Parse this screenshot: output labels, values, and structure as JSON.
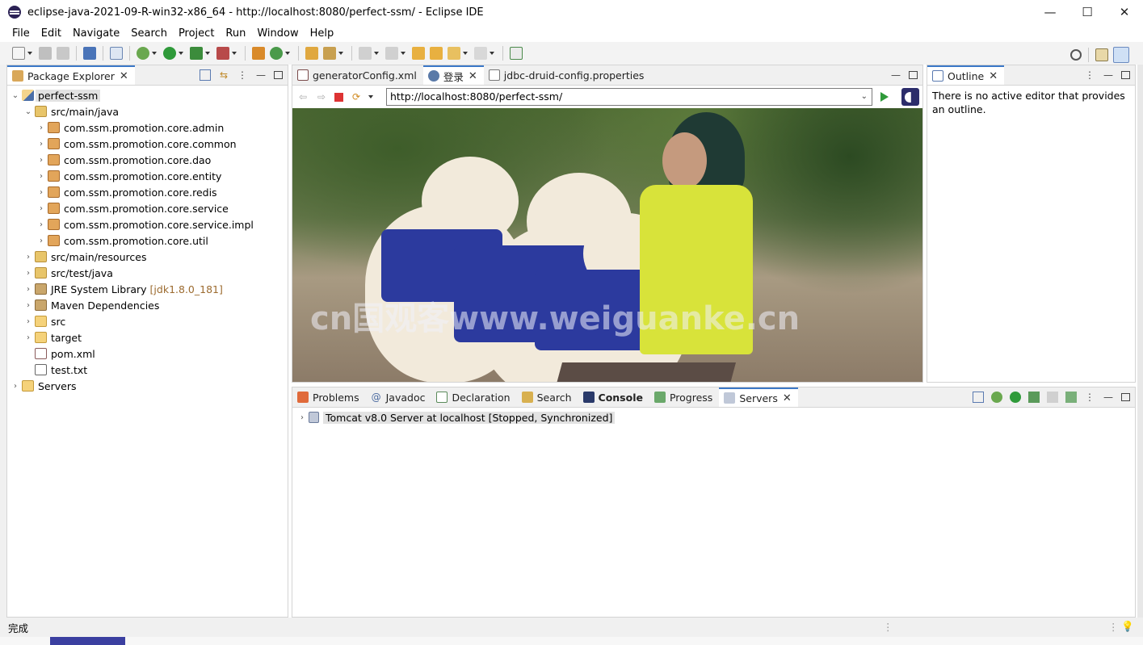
{
  "window": {
    "title": "eclipse-java-2021-09-R-win32-x86_64 - http://localhost:8080/perfect-ssm/ - Eclipse IDE",
    "minimize": "—",
    "maximize": "☐",
    "close": "✕"
  },
  "menu": [
    "File",
    "Edit",
    "Navigate",
    "Search",
    "Project",
    "Run",
    "Window",
    "Help"
  ],
  "package_explorer": {
    "title": "Package Explorer",
    "tree": [
      {
        "label": "perfect-ssm",
        "level": 0,
        "icon": "project-icon",
        "expanded": true
      },
      {
        "label": "src/main/java",
        "level": 1,
        "icon": "source-folder-icon",
        "expanded": true
      },
      {
        "label": "com.ssm.promotion.core.admin",
        "level": 2,
        "icon": "package-icon"
      },
      {
        "label": "com.ssm.promotion.core.common",
        "level": 2,
        "icon": "package-icon"
      },
      {
        "label": "com.ssm.promotion.core.dao",
        "level": 2,
        "icon": "package-icon"
      },
      {
        "label": "com.ssm.promotion.core.entity",
        "level": 2,
        "icon": "package-icon"
      },
      {
        "label": "com.ssm.promotion.core.redis",
        "level": 2,
        "icon": "package-icon"
      },
      {
        "label": "com.ssm.promotion.core.service",
        "level": 2,
        "icon": "package-icon"
      },
      {
        "label": "com.ssm.promotion.core.service.impl",
        "level": 2,
        "icon": "package-icon"
      },
      {
        "label": "com.ssm.promotion.core.util",
        "level": 2,
        "icon": "package-icon"
      },
      {
        "label": "src/main/resources",
        "level": 1,
        "icon": "source-folder-icon"
      },
      {
        "label": "src/test/java",
        "level": 1,
        "icon": "source-folder-icon"
      },
      {
        "label": "JRE System Library",
        "decor": "[jdk1.8.0_181]",
        "level": 1,
        "icon": "library-icon"
      },
      {
        "label": "Maven Dependencies",
        "level": 1,
        "icon": "library-icon"
      },
      {
        "label": "src",
        "level": 1,
        "icon": "folder-icon"
      },
      {
        "label": "target",
        "level": 1,
        "icon": "folder-icon"
      },
      {
        "label": "pom.xml",
        "level": 1,
        "icon": "xml-file-icon",
        "leaf": true
      },
      {
        "label": "test.txt",
        "level": 1,
        "icon": "text-file-icon",
        "leaf": true
      },
      {
        "label": "Servers",
        "level": 0,
        "icon": "servers-folder-icon"
      }
    ]
  },
  "editor": {
    "tabs": [
      {
        "label": "generatorConfig.xml",
        "active": false
      },
      {
        "label": "登录",
        "active": true
      },
      {
        "label": "jdbc-druid-config.properties",
        "active": false
      }
    ],
    "url": "http://localhost:8080/perfect-ssm/",
    "watermark": "cn国观客www.weiguanke.cn"
  },
  "outline": {
    "title": "Outline",
    "message": "There is no active editor that provides an outline."
  },
  "bottom_panel": {
    "tabs": [
      {
        "label": "Problems",
        "active": false
      },
      {
        "label": "Javadoc",
        "active": false
      },
      {
        "label": "Declaration",
        "active": false
      },
      {
        "label": "Search",
        "active": false
      },
      {
        "label": "Console",
        "active": false,
        "bold": true
      },
      {
        "label": "Progress",
        "active": false
      },
      {
        "label": "Servers",
        "active": true
      }
    ],
    "server": "Tomcat v8.0 Server at localhost  [Stopped, Synchronized]"
  },
  "status": {
    "text": "完成"
  },
  "colors": {
    "accent": "#3b78c7",
    "selection": "#e2e2e2",
    "tabbar": "#f0f0f0",
    "decor": "#9c6b2f"
  }
}
